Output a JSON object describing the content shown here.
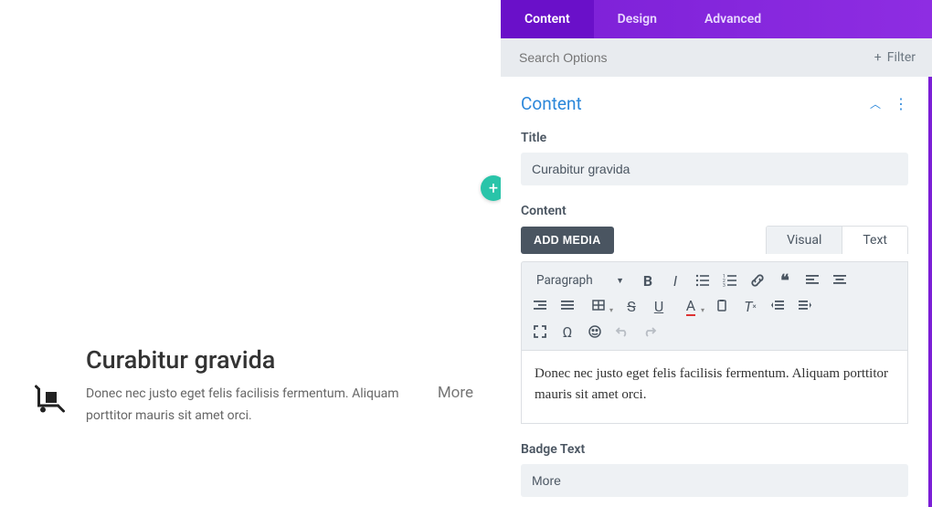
{
  "preview": {
    "title": "Curabitur gravida",
    "body": "Donec nec justo eget felis facilisis fermentum. Aliquam porttitor mauris sit amet orci.",
    "more_label": "More"
  },
  "tabs": {
    "content": "Content",
    "design": "Design",
    "advanced": "Advanced"
  },
  "search": {
    "placeholder": "Search Options",
    "filter_label": "Filter"
  },
  "section": {
    "title": "Content"
  },
  "fields": {
    "title_label": "Title",
    "title_value": "Curabitur gravida",
    "content_label": "Content",
    "add_media": "ADD MEDIA",
    "visual_tab": "Visual",
    "text_tab": "Text",
    "paragraph_dd": "Paragraph",
    "editor_body": "Donec nec justo eget felis facilisis fermentum. Aliquam porttitor mauris sit amet orci.",
    "badge_label": "Badge Text",
    "badge_value": "More"
  }
}
